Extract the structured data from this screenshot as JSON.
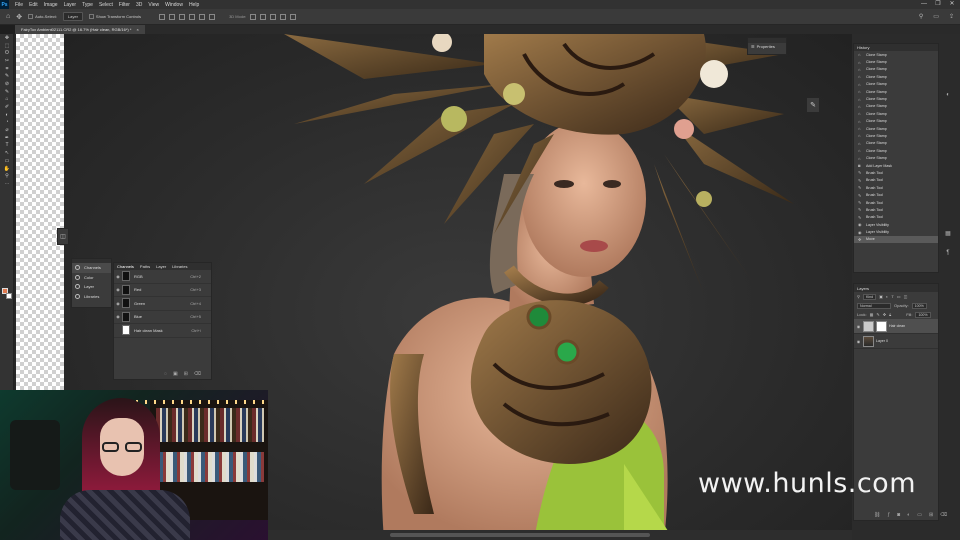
{
  "app": {
    "logo": "Ps",
    "menu": [
      "File",
      "Edit",
      "Image",
      "Layer",
      "Type",
      "Select",
      "Filter",
      "3D",
      "View",
      "Window",
      "Help"
    ],
    "window_controls": [
      "—",
      "❐",
      "✕"
    ]
  },
  "options_bar": {
    "auto_select_label": "Auto-Select:",
    "auto_select_value": "Layer",
    "transform_controls_label": "Show Transform Controls",
    "mode_label": "3D Mode:"
  },
  "document_tab": {
    "label": "FairyTox Ambient02111.CR2 @ 16.7% (Hair clean, RGB/16*) *",
    "close": "×"
  },
  "tools": [
    "✥",
    "⬚",
    "ʘ",
    "✂",
    "⌗",
    "✎",
    "⊘",
    "✎",
    "⌂",
    "✐",
    "◐",
    "◔",
    "⌀",
    "✒",
    "T",
    "↖",
    "▭",
    "✋",
    "⚲",
    "⋯"
  ],
  "colors": {
    "foreground": "#e07a50",
    "background": "#ffffff",
    "accent": "#31a8ff"
  },
  "properties_panel": {
    "label": "Properties",
    "icon": "sliders-icon"
  },
  "group_panel": {
    "items": [
      {
        "label": "Channels",
        "icon": "channels-icon",
        "active": true
      },
      {
        "label": "Color",
        "icon": "color-icon",
        "active": false
      },
      {
        "label": "Layer",
        "icon": "layer-icon",
        "active": false
      },
      {
        "label": "Libraries",
        "icon": "libraries-icon",
        "active": false
      }
    ]
  },
  "channels_panel": {
    "tabs": [
      "Channels",
      "Paths",
      "Layer",
      "Libraries"
    ],
    "rows": [
      {
        "label": "RGB",
        "key": "Ctrl+2"
      },
      {
        "label": "Red",
        "key": "Ctrl+3"
      },
      {
        "label": "Green",
        "key": "Ctrl+4"
      },
      {
        "label": "Blue",
        "key": "Ctrl+5"
      },
      {
        "label": "Hair clean Mask",
        "key": "Ctrl+\\"
      }
    ]
  },
  "history_panel": {
    "title": "History",
    "items": [
      "Clone Stamp",
      "Clone Stamp",
      "Clone Stamp",
      "Clone Stamp",
      "Clone Stamp",
      "Clone Stamp",
      "Clone Stamp",
      "Clone Stamp",
      "Clone Stamp",
      "Clone Stamp",
      "Clone Stamp",
      "Clone Stamp",
      "Clone Stamp",
      "Clone Stamp",
      "Clone Stamp",
      "Add Layer Mask",
      "Brush Tool",
      "Brush Tool",
      "Brush Tool",
      "Brush Tool",
      "Brush Tool",
      "Brush Tool",
      "Brush Tool",
      "Layer Visibility",
      "Layer Visibility",
      "Move"
    ],
    "selected_index": 25
  },
  "layers_panel": {
    "title": "Layers",
    "filter_label": "Kind",
    "blend_mode": "Normal",
    "opacity_label": "Opacity:",
    "opacity_value": "100%",
    "lock_label": "Lock:",
    "fill_label": "Fill:",
    "fill_value": "100%",
    "layers": [
      {
        "name": "Hair clean",
        "selected": true,
        "has_mask": true
      },
      {
        "name": "Layer 0",
        "selected": false,
        "has_mask": false
      }
    ]
  },
  "watermark": "www.hunls.com"
}
